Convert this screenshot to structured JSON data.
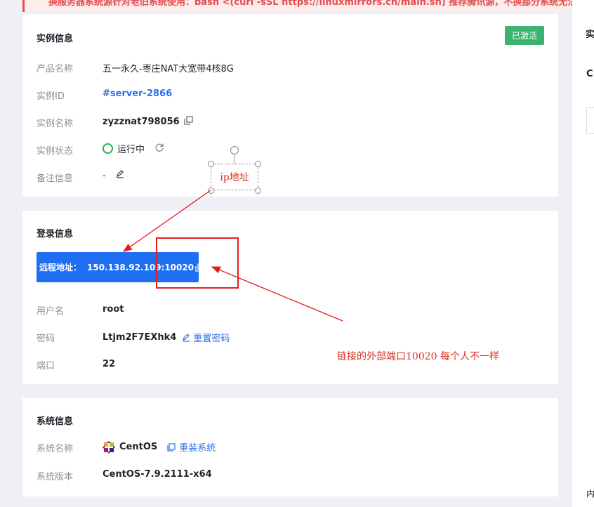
{
  "alert": {
    "text": "换服务器系统源针对老旧系统使用：bash <(curl -sSL https://linuxmirrors.cn/main.sh) 推荐腾讯源，不换部分系统无法正常"
  },
  "instance": {
    "title": "实例信息",
    "badge": "已激活",
    "product_label": "产品名称",
    "product_value": "五一永久-枣庄NAT大宽带4核8G",
    "id_label": "实例ID",
    "id_value": "#server-2866",
    "name_label": "实例名称",
    "name_value": "zyzznat798056",
    "status_label": "实例状态",
    "status_value": "运行中",
    "remark_label": "备注信息",
    "remark_value": "-"
  },
  "login": {
    "title": "登录信息",
    "remote_label": "远程地址：",
    "remote_value": "150.138.92.109:10020",
    "user_label": "用户名",
    "user_value": "root",
    "password_label": "密码",
    "password_value": "Ltjm2F7EXhk4",
    "reset_password": "重置密码",
    "port_label": "端口",
    "port_value": "22"
  },
  "system": {
    "title": "系统信息",
    "name_label": "系统名称",
    "name_value": "CentOS",
    "reinstall": "重装系统",
    "version_label": "系统版本",
    "version_value": "CentOS-7.9.2111-x64"
  },
  "right_panel": {
    "title_fragment": "实",
    "letter_fragment": "C",
    "bottom_fragment": "内"
  },
  "annotations": {
    "ip_note": "ip地址",
    "port_note": "链接的外部端口10020 每个人不一样"
  },
  "colors": {
    "primary": "#1e6ff2",
    "active_badge": "#3cb371",
    "status_green": "#2bb24c",
    "annotation_red": "#e61c1c"
  }
}
